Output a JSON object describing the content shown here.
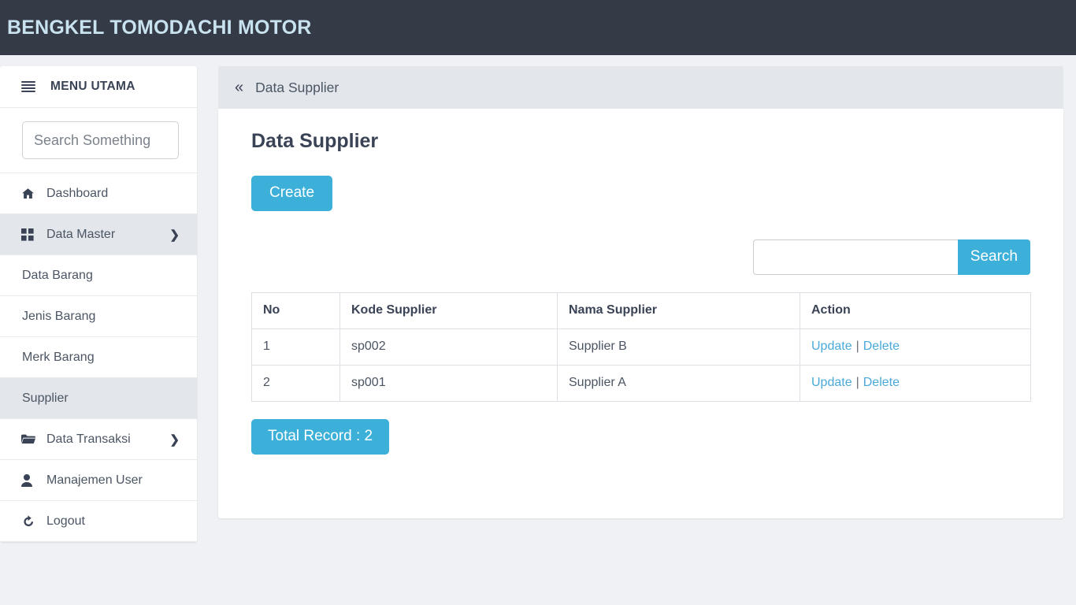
{
  "topbar": {
    "brand": "BENGKEL TOMODACHI MOTOR"
  },
  "sidebar": {
    "menu_header": "MENU UTAMA",
    "search_placeholder": "Search Something",
    "search_value": "",
    "items": [
      {
        "label": "Dashboard",
        "icon": "home-icon",
        "type": "main",
        "active": false,
        "caret": false
      },
      {
        "label": "Data Master",
        "icon": "grid-icon",
        "type": "main",
        "active": true,
        "caret": true
      },
      {
        "label": "Data Barang",
        "icon": "",
        "type": "sub",
        "active": false,
        "caret": false
      },
      {
        "label": "Jenis Barang",
        "icon": "",
        "type": "sub",
        "active": false,
        "caret": false
      },
      {
        "label": "Merk Barang",
        "icon": "",
        "type": "sub",
        "active": false,
        "caret": false
      },
      {
        "label": "Supplier",
        "icon": "",
        "type": "sub",
        "active": true,
        "caret": false
      },
      {
        "label": "Data Transaksi",
        "icon": "folder-icon",
        "type": "main",
        "active": false,
        "caret": true
      },
      {
        "label": "Manajemen User",
        "icon": "user-icon",
        "type": "main",
        "active": false,
        "caret": false
      },
      {
        "label": "Logout",
        "icon": "sign-out-icon",
        "type": "main",
        "active": false,
        "caret": false
      }
    ]
  },
  "breadcrumb": {
    "collapse_icon": "«",
    "text": "Data Supplier"
  },
  "main": {
    "page_title": "Data Supplier",
    "create_label": "Create",
    "search_placeholder": "",
    "search_value": "",
    "search_button": "Search",
    "total_record": "Total Record : 2",
    "table": {
      "columns": [
        "No",
        "Kode Supplier",
        "Nama Supplier",
        "Action"
      ],
      "rows": [
        {
          "no": "1",
          "kode": "sp002",
          "nama": "Supplier B",
          "update": "Update",
          "sep": "|",
          "delete": "Delete"
        },
        {
          "no": "2",
          "kode": "sp001",
          "nama": "Supplier A",
          "update": "Update",
          "sep": "|",
          "delete": "Delete"
        }
      ]
    }
  },
  "colors": {
    "accent": "#3cb0d8",
    "topbar_bg": "#343a46",
    "brand_text": "#c9e2ef",
    "page_bg": "#eff1f4",
    "link": "#4aa9d9",
    "active_item_bg": "#e3e7eb"
  }
}
